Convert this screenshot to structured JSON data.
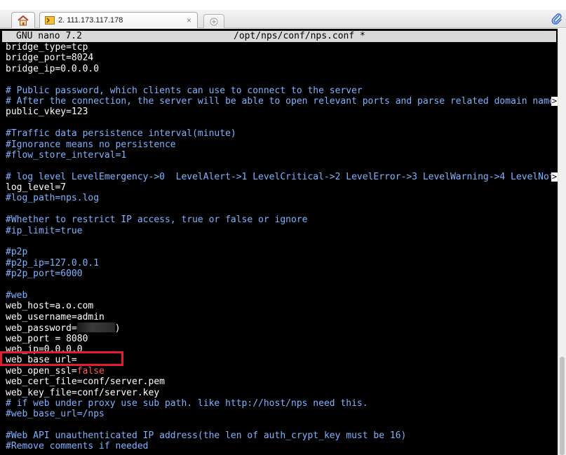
{
  "tabs": {
    "home_icon": "home-icon",
    "session_label": "2. 111.173.117.178",
    "close_label": "×",
    "new_tab_icon": "plus-icon",
    "attachment_icon": "paperclip-icon"
  },
  "editor": {
    "app_name": "GNU nano 7.2",
    "file_path": "/opt/nps/conf/nps.conf *",
    "lines": [
      "bridge_type=tcp",
      "bridge_port=8024",
      "bridge_ip=0.0.0.0",
      "",
      "# Public password, which clients can use to connect to the server",
      "# After the connection, the server will be able to open relevant ports and parse related domain name",
      "public_vkey=123",
      "",
      "#Traffic data persistence interval(minute)",
      "#Ignorance means no persistence",
      "#flow_store_interval=1",
      "",
      "# log level LevelEmergency->0  LevelAlert->1 LevelCritical->2 LevelError->3 LevelWarning->4 LevelNot",
      "log_level=7",
      "#log_path=nps.log",
      "",
      "#Whether to restrict IP access, true or false or ignore",
      "#ip_limit=true",
      "",
      "#p2p",
      "#p2p_ip=127.0.0.1",
      "#p2p_port=6000",
      "",
      "#web",
      "web_host=a.o.com",
      "web_username=admin",
      "web_password=",
      "web_port = 8080",
      "web_ip=0.0.0.0",
      "web_base_url=",
      "web_open_ssl=",
      "web_cert_file=conf/server.pem",
      "web_key_file=conf/server.key",
      "# if web under proxy use sub path. like http://host/nps need this.",
      "#web_base_url=/nps",
      "",
      "#Web API unauthenticated IP address(the len of auth_crypt_key must be 16)",
      "#Remove comments if needed"
    ],
    "web_open_ssl_value": "false",
    "truncation_marker": ">",
    "web_password_suffix": ")"
  }
}
